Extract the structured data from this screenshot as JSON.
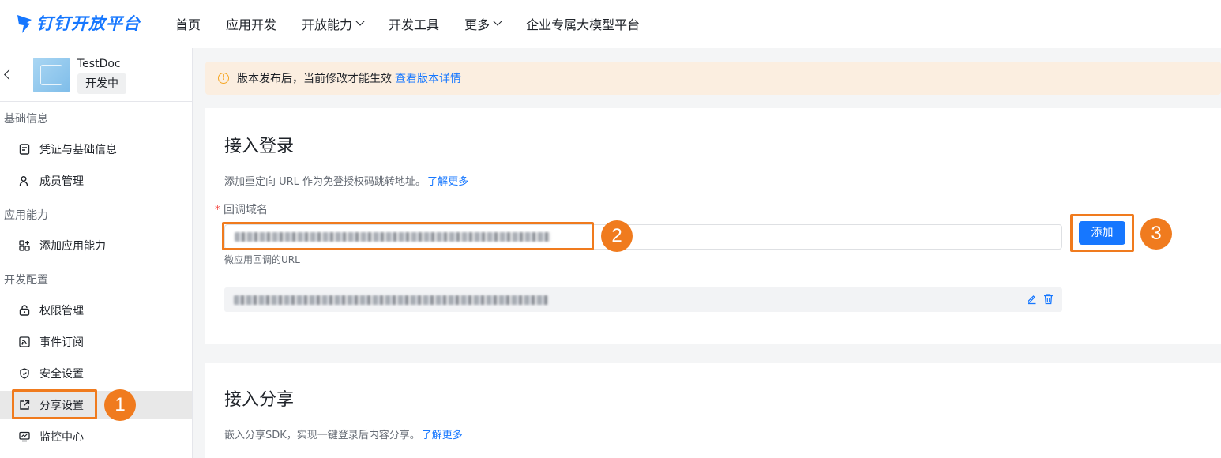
{
  "brand": {
    "name": "钉钉开放平台",
    "color": "#1677ff"
  },
  "nav": {
    "items": [
      {
        "label": "首页",
        "dropdown": false
      },
      {
        "label": "应用开发",
        "dropdown": false
      },
      {
        "label": "开放能力",
        "dropdown": true
      },
      {
        "label": "开发工具",
        "dropdown": false
      },
      {
        "label": "更多",
        "dropdown": true
      },
      {
        "label": "企业专属大模型平台",
        "dropdown": false
      }
    ]
  },
  "app": {
    "name": "TestDoc",
    "status": "开发中"
  },
  "sidebar": {
    "sections": [
      {
        "title": "基础信息",
        "items": [
          {
            "label": "凭证与基础信息",
            "icon": "credential-icon"
          },
          {
            "label": "成员管理",
            "icon": "user-icon"
          }
        ]
      },
      {
        "title": "应用能力",
        "items": [
          {
            "label": "添加应用能力",
            "icon": "apps-add-icon"
          }
        ]
      },
      {
        "title": "开发配置",
        "items": [
          {
            "label": "权限管理",
            "icon": "lock-icon"
          },
          {
            "label": "事件订阅",
            "icon": "rss-icon"
          },
          {
            "label": "安全设置",
            "icon": "shield-icon"
          },
          {
            "label": "分享设置",
            "icon": "share-icon",
            "active": true
          },
          {
            "label": "监控中心",
            "icon": "monitor-icon"
          }
        ]
      }
    ]
  },
  "notice": {
    "text": "版本发布后，当前修改才能生效",
    "link": "查看版本详情",
    "accent": "#f5a623"
  },
  "login_card": {
    "title": "接入登录",
    "desc": "添加重定向 URL 作为免登授权码跳转地址。",
    "desc_link": "了解更多",
    "field_label": "回调域名",
    "required_mark": "*",
    "hint": "微应用回调的URL",
    "add_button": "添加"
  },
  "share_card": {
    "title": "接入分享",
    "desc": "嵌入分享SDK，实现一键登录后内容分享。",
    "desc_link": "了解更多"
  },
  "annotations": {
    "color": "#f07b1e",
    "badges": [
      "1",
      "2",
      "3"
    ]
  }
}
